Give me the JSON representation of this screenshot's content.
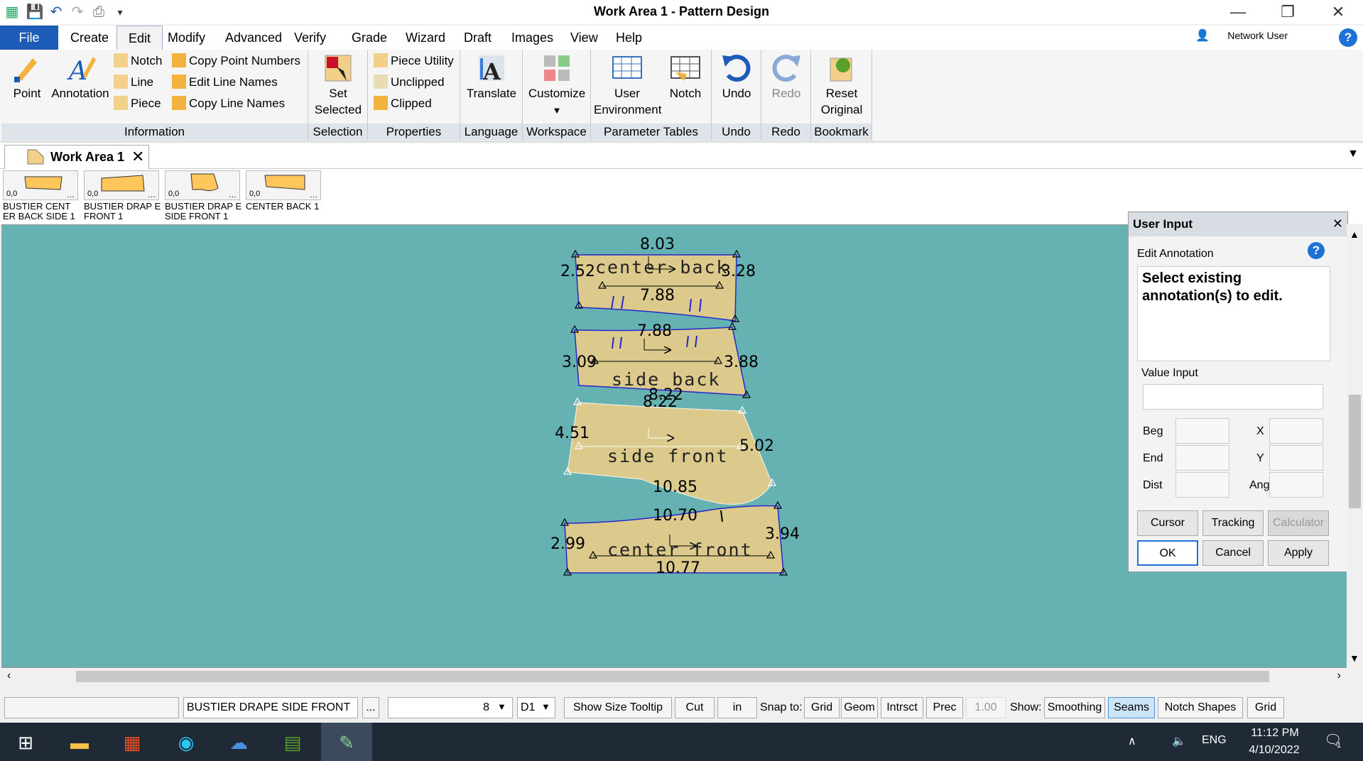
{
  "window": {
    "title": "Work Area 1 - Pattern Design",
    "minimize": "—",
    "restore": "❐",
    "close": "✕"
  },
  "menu": {
    "file": "File",
    "items": [
      "Create",
      "Edit",
      "Modify",
      "Advanced",
      "Verify",
      "Grade",
      "Wizard",
      "Draft",
      "Images",
      "View",
      "Help"
    ],
    "active": "Edit",
    "network_user": "Network User",
    "help": "?"
  },
  "ribbon": {
    "information": {
      "label": "Information",
      "point": "Point",
      "annotation": "Annotation",
      "notch": "Notch",
      "line": "Line",
      "piece": "Piece",
      "copy_point_numbers": "Copy Point Numbers",
      "edit_line_names": "Edit Line Names",
      "copy_line_names": "Copy Line Names"
    },
    "selection": {
      "label": "Selection",
      "set": "Set",
      "selected": "Selected"
    },
    "properties": {
      "label": "Properties",
      "piece_utility": "Piece Utility",
      "unclipped": "Unclipped",
      "clipped": "Clipped"
    },
    "language": {
      "label": "Language",
      "translate": "Translate"
    },
    "workspace": {
      "label": "Workspace",
      "customize": "Customize"
    },
    "parameter_tables": {
      "label": "Parameter Tables",
      "user": "User",
      "environment": "Environment",
      "notch": "Notch"
    },
    "undo": {
      "label": "Undo",
      "button": "Undo"
    },
    "redo": {
      "label": "Redo",
      "button": "Redo"
    },
    "bookmark": {
      "label": "Bookmark",
      "reset": "Reset",
      "original": "Original"
    }
  },
  "tabs": {
    "work_area": "Work Area 1",
    "close": "✕"
  },
  "thumbnails": [
    {
      "count": "0,0",
      "label": "BUSTIER CENT ER BACK SIDE 1"
    },
    {
      "count": "0,0",
      "label": "BUSTIER DRAP E FRONT 1"
    },
    {
      "count": "0,0",
      "label": "BUSTIER DRAP E SIDE FRONT 1"
    },
    {
      "count": "0,0",
      "label": "CENTER BACK 1"
    }
  ],
  "pieces": {
    "center_back": {
      "name": "center back",
      "top": "8.03",
      "left": "2.52",
      "right": "3.28",
      "bottom": "7.88"
    },
    "side_back": {
      "name": "side back",
      "top": "7.88",
      "left": "3.09",
      "right": "3.88",
      "bottom": "8.22"
    },
    "side_front": {
      "name": "side front",
      "top": "8.22",
      "left": "4.51",
      "right": "5.02",
      "bottom": "10.85"
    },
    "center_front": {
      "name": "center front",
      "top": "10.70",
      "left": "2.99",
      "right": "3.94",
      "bottom": "10.77"
    }
  },
  "user_input": {
    "title": "User Input",
    "close": "✕",
    "subtitle": "Edit Annotation",
    "help": "?",
    "message": "Select existing annotation(s) to edit.",
    "value_input": "Value Input",
    "beg": "Beg",
    "end": "End",
    "dist": "Dist",
    "x": "X",
    "y": "Y",
    "ang": "Ang",
    "cursor": "Cursor",
    "tracking": "Tracking",
    "calculator": "Calculator",
    "ok": "OK",
    "cancel": "Cancel",
    "apply": "Apply"
  },
  "status": {
    "piece_name": "BUSTIER DRAPE SIDE FRONT",
    "browse": "...",
    "size": "8",
    "dim": "D1",
    "show_size_tooltip": "Show Size Tooltip",
    "cut": "Cut",
    "unit": "in",
    "snap_to": "Snap to:",
    "grid": "Grid",
    "geom": "Geom",
    "intrsct": "Intrsct",
    "prec": "Prec",
    "prec_value": "1.00",
    "show": "Show:",
    "smoothing": "Smoothing",
    "seams": "Seams",
    "notch_shapes": "Notch Shapes",
    "grid2": "Grid"
  },
  "taskbar": {
    "lang": "ENG",
    "time": "11:12 PM",
    "date": "4/10/2022",
    "notif": "1"
  },
  "colors": {
    "work_bg": "#66b2b2",
    "piece_fill": "#dcc98c",
    "piece_stroke": "#2727c9",
    "file_menu": "#1d5bb8",
    "seams_active": "#cce4f7"
  }
}
